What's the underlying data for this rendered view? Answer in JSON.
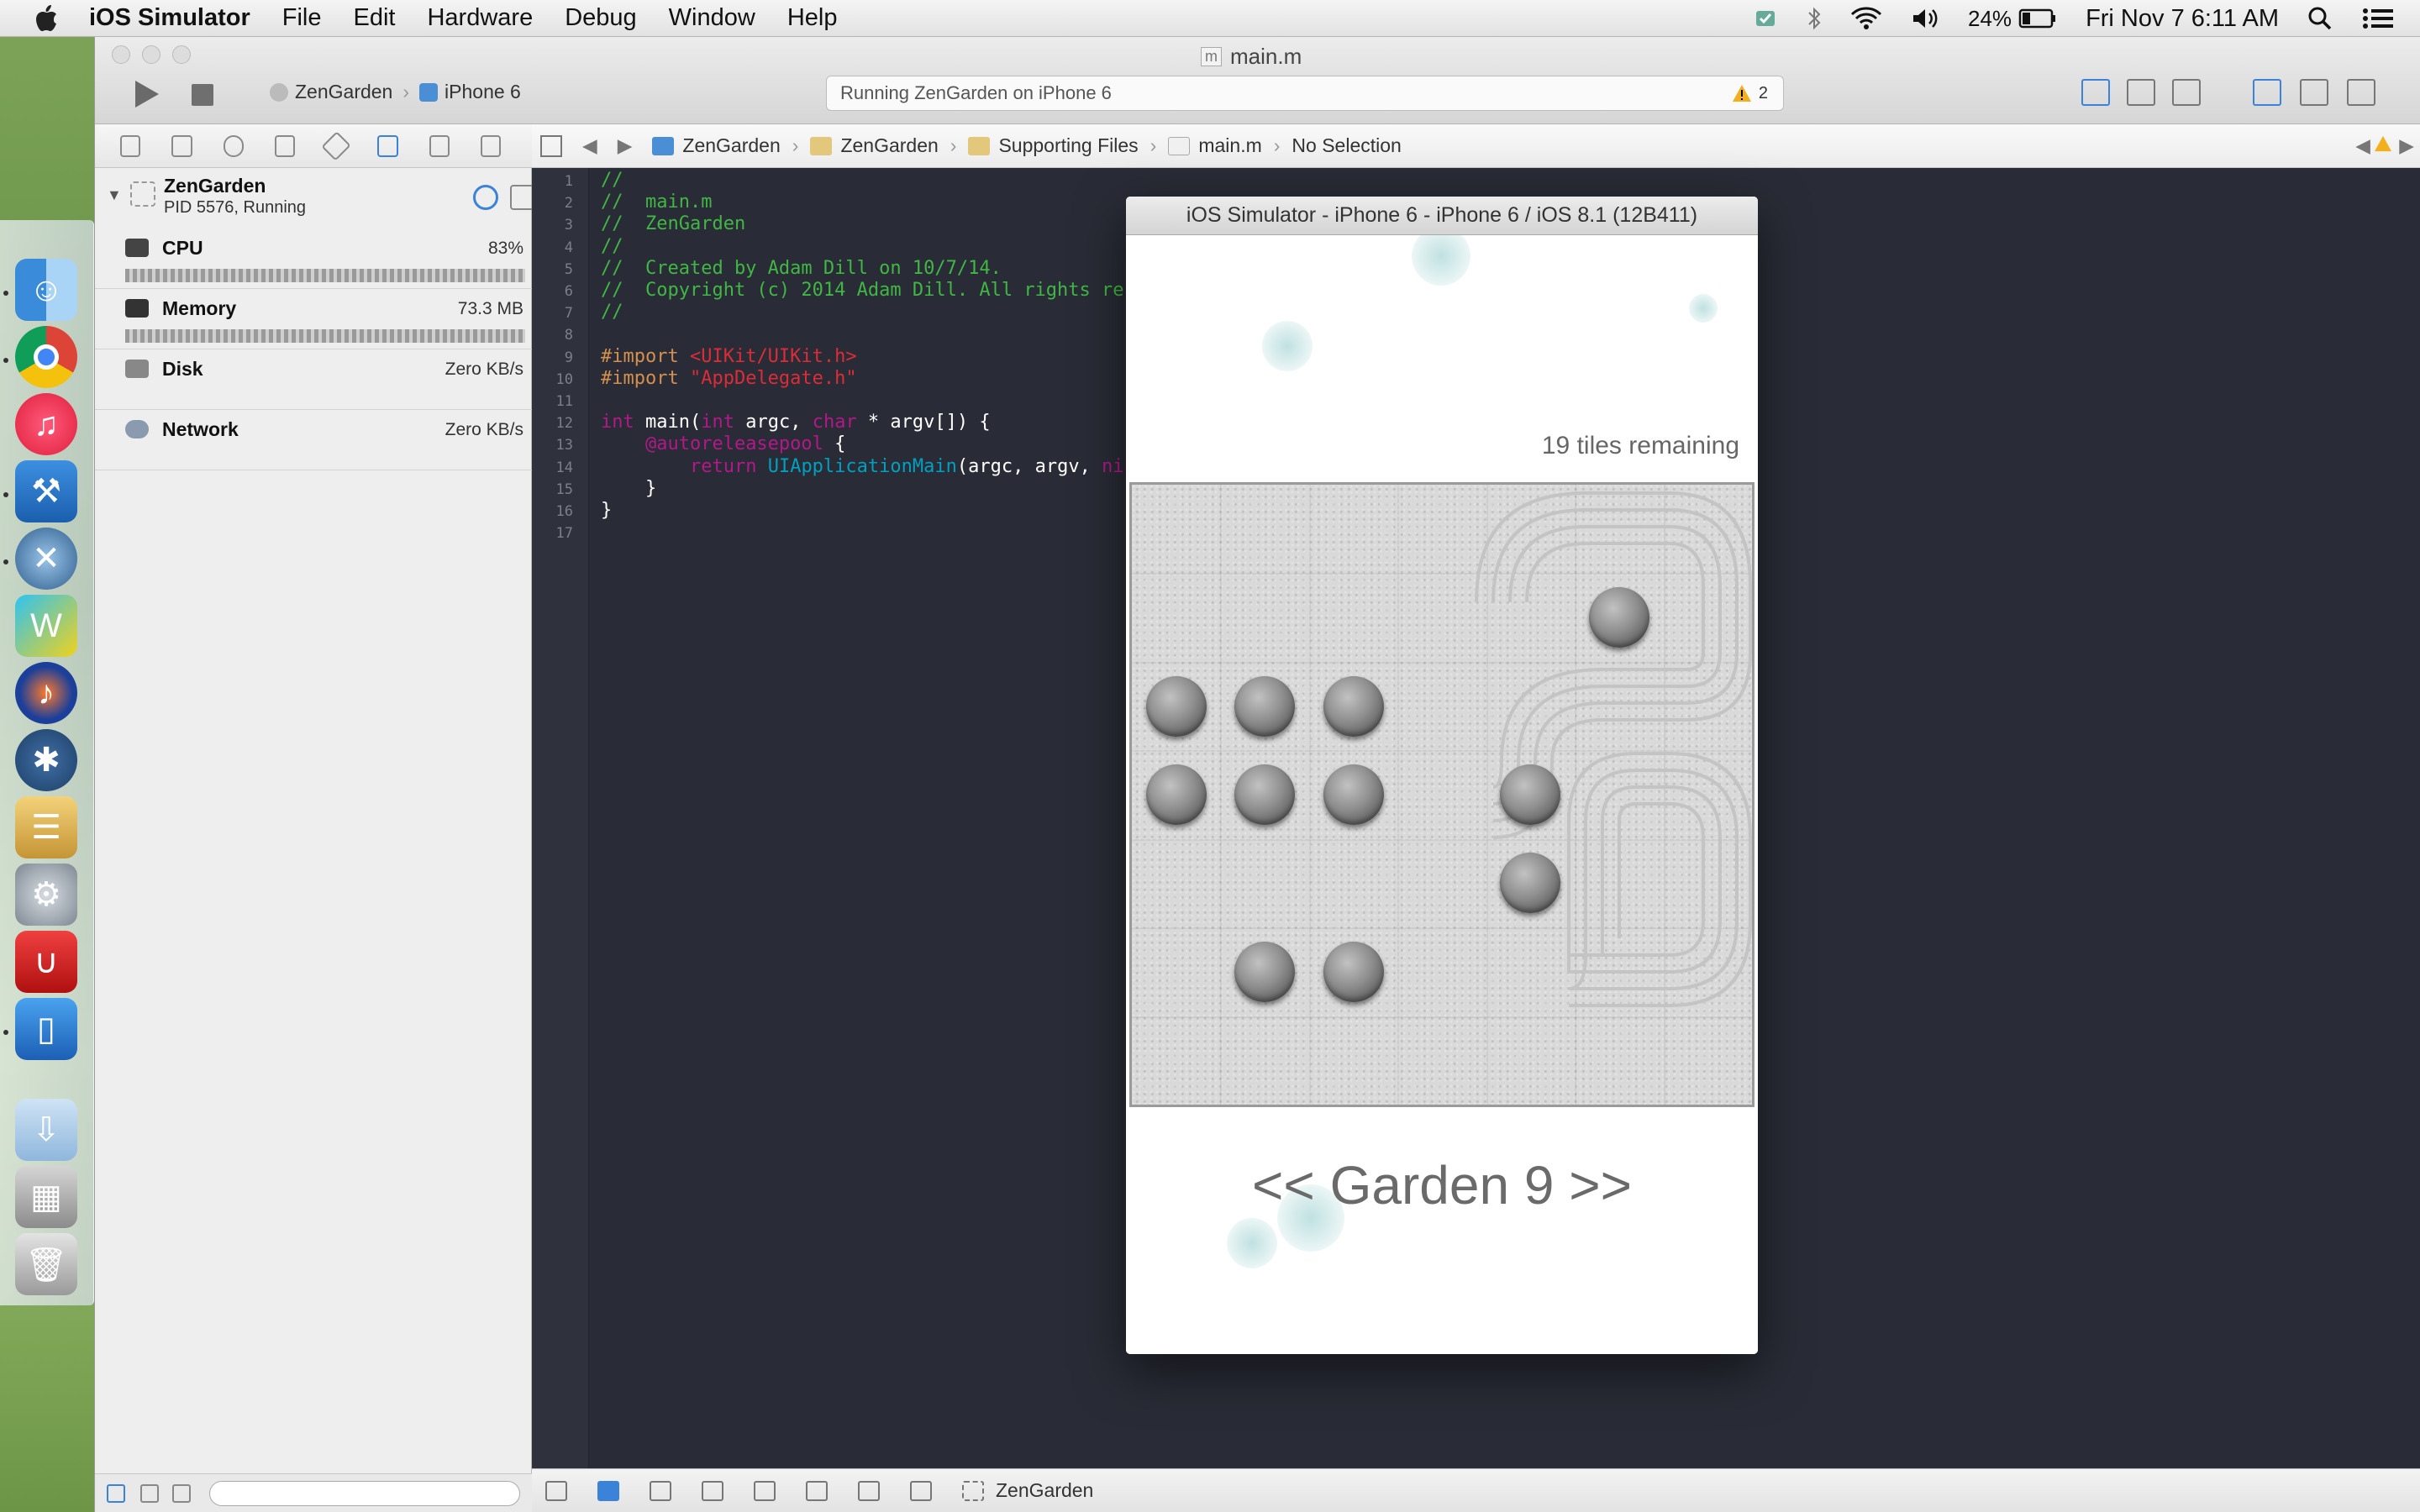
{
  "menubar": {
    "app": "iOS Simulator",
    "items": [
      "File",
      "Edit",
      "Hardware",
      "Debug",
      "Window",
      "Help"
    ],
    "battery": "24%",
    "clock": "Fri Nov 7  6:11 AM"
  },
  "window": {
    "title": "main.m",
    "file_badge": "m"
  },
  "toolbar": {
    "scheme": "ZenGarden",
    "device": "iPhone 6",
    "activity": "Running ZenGarden on iPhone 6",
    "warning_count": "2"
  },
  "jumpbar": {
    "crumbs": [
      "ZenGarden",
      "ZenGarden",
      "Supporting Files",
      "main.m",
      "No Selection"
    ]
  },
  "debug_nav": {
    "process_name": "ZenGarden",
    "process_status": "PID 5576, Running",
    "gauges": [
      {
        "label": "CPU",
        "value": "83%"
      },
      {
        "label": "Memory",
        "value": "73.3 MB"
      },
      {
        "label": "Disk",
        "value": "Zero KB/s"
      },
      {
        "label": "Network",
        "value": "Zero KB/s"
      }
    ]
  },
  "editor": {
    "line_numbers": [
      "1",
      "2",
      "3",
      "4",
      "5",
      "6",
      "7",
      "8",
      "9",
      "10",
      "11",
      "12",
      "13",
      "14",
      "15",
      "16",
      "17"
    ],
    "lines": [
      [
        {
          "t": "//",
          "c": "com"
        }
      ],
      [
        {
          "t": "//  main.m",
          "c": "com"
        }
      ],
      [
        {
          "t": "//  ZenGarden",
          "c": "com"
        }
      ],
      [
        {
          "t": "//",
          "c": "com"
        }
      ],
      [
        {
          "t": "//  Created by Adam Dill on 10/7/14.",
          "c": "com"
        }
      ],
      [
        {
          "t": "//  Copyright (c) 2014 Adam Dill. All rights re",
          "c": "com"
        }
      ],
      [
        {
          "t": "//",
          "c": "com"
        }
      ],
      [],
      [
        {
          "t": "#import ",
          "c": "pp"
        },
        {
          "t": "<UIKit/UIKit.h>",
          "c": "str"
        }
      ],
      [
        {
          "t": "#import ",
          "c": "pp"
        },
        {
          "t": "\"AppDelegate.h\"",
          "c": "str"
        }
      ],
      [],
      [
        {
          "t": "int",
          "c": "kw"
        },
        {
          "t": " main(",
          "c": "plain"
        },
        {
          "t": "int",
          "c": "kw"
        },
        {
          "t": " argc, ",
          "c": "plain"
        },
        {
          "t": "char",
          "c": "kw"
        },
        {
          "t": " * argv[]) {",
          "c": "plain"
        }
      ],
      [
        {
          "t": "    ",
          "c": "plain"
        },
        {
          "t": "@autoreleasepool",
          "c": "kw"
        },
        {
          "t": " {",
          "c": "plain"
        }
      ],
      [
        {
          "t": "        ",
          "c": "plain"
        },
        {
          "t": "return",
          "c": "kw"
        },
        {
          "t": " ",
          "c": "plain"
        },
        {
          "t": "UIApplicationMain",
          "c": "fn"
        },
        {
          "t": "(argc, argv, ",
          "c": "plain"
        },
        {
          "t": "ni",
          "c": "kw"
        }
      ],
      [
        {
          "t": "    }",
          "c": "plain"
        }
      ],
      [
        {
          "t": "}",
          "c": "plain"
        }
      ],
      []
    ]
  },
  "debugbar": {
    "target": "ZenGarden"
  },
  "simulator": {
    "title": "iOS Simulator - iPhone 6 - iPhone 6 / iOS 8.1 (12B411)",
    "tiles_remaining": "19 tiles remaining",
    "garden_label": "<< Garden 9 >>"
  },
  "dock": {
    "apps": [
      "finder-icon",
      "chrome-icon",
      "itunes-icon",
      "xcode-icon",
      "x11-icon",
      "webstorm-icon",
      "audacity-icon",
      "sourcetree-icon",
      "sequel-pro-icon",
      "system-preferences-icon",
      "magnet-icon",
      "simulator-icon",
      "downloads-icon",
      "screenshots-icon",
      "trash-icon"
    ]
  }
}
